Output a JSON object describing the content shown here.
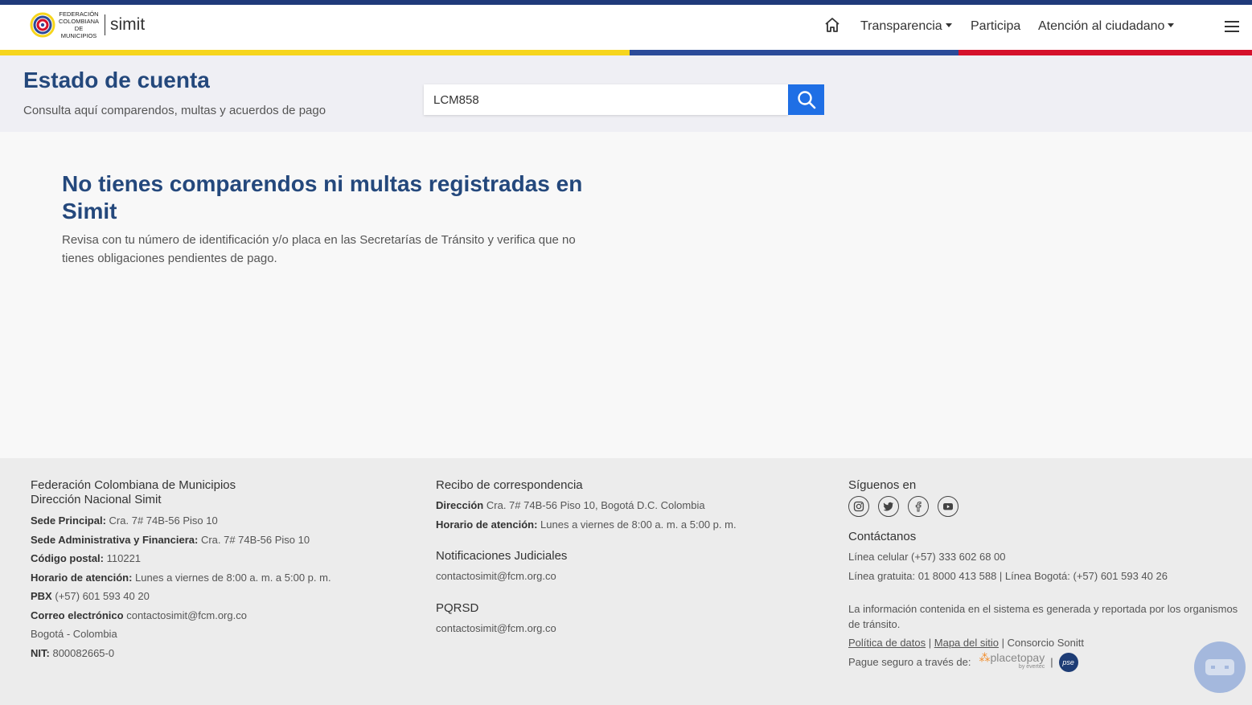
{
  "brand": {
    "fcm_line1": "FEDERACIÓN",
    "fcm_line2": "COLOMBIANA",
    "fcm_line3": "DE MUNICIPIOS",
    "simit": "simit",
    "colors": {
      "navy": "#1f3a7a",
      "yellow": "#f6d51d",
      "blue": "#2b4a98",
      "red": "#d5112b",
      "title": "#24487c",
      "search_button": "#1f6fe5"
    }
  },
  "nav": {
    "home_icon": "home-icon",
    "items": [
      {
        "label": "Transparencia",
        "dropdown": true
      },
      {
        "label": "Participa",
        "dropdown": false
      },
      {
        "label": "Atención al ciudadano",
        "dropdown": true
      }
    ],
    "menu_icon": "hamburger-menu-icon"
  },
  "header": {
    "title": "Estado de cuenta",
    "subtitle": "Consulta aquí comparendos, multas y acuerdos de pago",
    "search_value": "LCM858",
    "search_icon": "search-icon"
  },
  "main": {
    "title": "No tienes comparendos ni multas registradas en Simit",
    "body": "Revisa con tu número de identificación y/o placa en las Secretarías de Tránsito y verifica que no tienes obligaciones pendientes de pago."
  },
  "footer": {
    "col1": {
      "org1": "Federación Colombiana de Municipios",
      "org2": "Dirección Nacional Simit",
      "rows": [
        {
          "label": "Sede Principal:",
          "value": "Cra. 7# 74B-56 Piso 10"
        },
        {
          "label": "Sede Administrativa y Financiera:",
          "value": "Cra. 7# 74B-56 Piso 10"
        },
        {
          "label": "Código postal:",
          "value": "110221"
        },
        {
          "label": "Horario de atención:",
          "value": "Lunes a viernes de 8:00 a. m. a 5:00 p. m."
        },
        {
          "label": "PBX",
          "value": "(+57) 601 593 40 20"
        },
        {
          "label": "Correo electrónico",
          "value": "contactosimit@fcm.org.co"
        },
        {
          "label": "",
          "value": "Bogotá - Colombia"
        },
        {
          "label": "NIT:",
          "value": "800082665-0"
        }
      ]
    },
    "col2": {
      "heading1": "Recibo de correspondencia",
      "dir_label": "Dirección",
      "dir_value": "Cra. 7# 74B-56 Piso 10, Bogotá D.C. Colombia",
      "hours_label": "Horario de atención:",
      "hours_value": "Lunes a viernes de 8:00 a. m. a 5:00 p. m.",
      "heading2": "Notificaciones Judiciales",
      "email2": "contactosimit@fcm.org.co",
      "heading3": "PQRSD",
      "email3": "contactosimit@fcm.org.co"
    },
    "col3": {
      "social_heading": "Síguenos en",
      "social_icons": [
        "instagram-icon",
        "twitter-icon",
        "facebook-icon",
        "youtube-icon"
      ],
      "contact_heading": "Contáctanos",
      "phone1": "Línea celular (+57) 333 602 68 00",
      "phone2": "Línea gratuita: 01 8000 413 588 | Línea Bogotá: (+57) 601 593 40 26",
      "disclaimer": "La información contenida en el sistema es generada y reportada por los organismos de tránsito.",
      "link_privacy": "Política de datos",
      "sep": "|",
      "link_sitemap": "Mapa del sitio",
      "consortium": "| Consorcio Sonitt",
      "pay_text": "Pague seguro a través de:",
      "placetopay": "placetopay",
      "evertec": "by evertec",
      "pse": "pse"
    }
  },
  "chatbot_icon": "chatbot-icon"
}
